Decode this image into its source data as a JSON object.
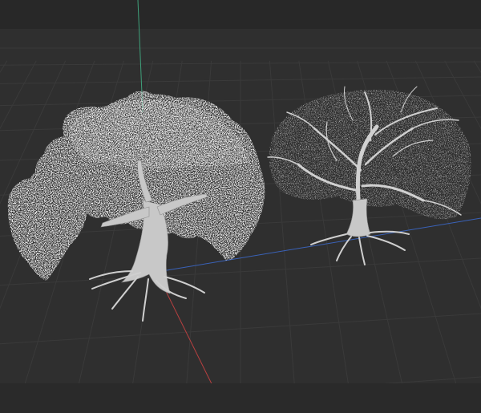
{
  "viewport": {
    "background": "#2f2f2f",
    "grid_color": "#3a3a3a",
    "axis_x_color": "#c04040",
    "axis_y_color": "#3a6ac8",
    "axis_z_color": "#3fa07a",
    "mesh_color": "#c9c9c9"
  },
  "objects": [
    {
      "name": "tree-with-foliage",
      "label": ""
    },
    {
      "name": "tree-bare-branches",
      "label": ""
    }
  ]
}
